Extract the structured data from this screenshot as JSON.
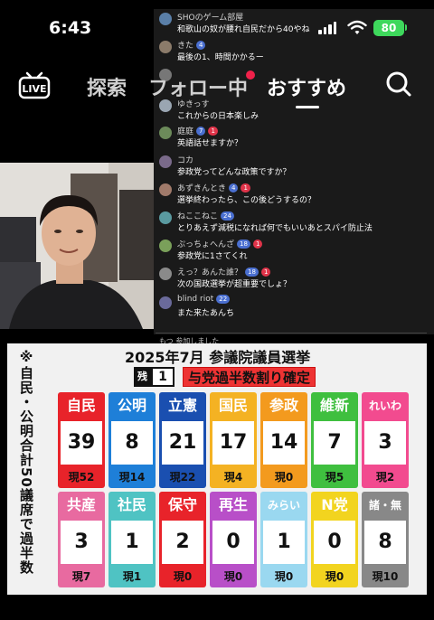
{
  "status_bar": {
    "time": "6:43",
    "battery": "80"
  },
  "nav": {
    "live_label": "LIVE",
    "tabs": [
      "探索",
      "フォロー中",
      "おすすめ"
    ]
  },
  "chat": [
    {
      "name": "SHOのゲーム部屋",
      "badges": [],
      "message": "和歌山の奴が腰れ自民だから40やね",
      "avatar_color": "#5a7fa8"
    },
    {
      "name": "きた",
      "badges": [
        {
          "text": "4",
          "color": "blue"
        }
      ],
      "message": "最後の1、時間かかるー",
      "avatar_color": "#8b7b6a"
    },
    {
      "name": "",
      "badges": [],
      "message": "",
      "avatar_color": "#777777"
    },
    {
      "name": "ゆきっす",
      "badges": [],
      "message": "これからの日本楽しみ",
      "avatar_color": "#9aa6b2"
    },
    {
      "name": "庭庭",
      "badges": [
        {
          "text": "7",
          "color": "blue"
        },
        {
          "text": "1",
          "color": "red"
        }
      ],
      "message": "英語話せますか？",
      "avatar_color": "#6c8a5a"
    },
    {
      "name": "コカ",
      "badges": [],
      "message": "参政党ってどんな政策ですか？",
      "avatar_color": "#7a6a8a"
    },
    {
      "name": "あずきんとき",
      "badges": [
        {
          "text": "4",
          "color": "blue"
        },
        {
          "text": "1",
          "color": "red"
        }
      ],
      "message": "選挙終わったら、この後どうするの？",
      "avatar_color": "#a07a6a"
    },
    {
      "name": "ねここねこ",
      "badges": [
        {
          "text": "24",
          "color": "blue"
        }
      ],
      "message": "とりあえず減税になれば何でもいいあとスパイ防止法",
      "avatar_color": "#5a9aa0"
    },
    {
      "name": "ぷっちょへんざ",
      "badges": [
        {
          "text": "18",
          "color": "blue"
        },
        {
          "text": "1",
          "color": "red"
        }
      ],
      "message": "参政党に1さてくれ",
      "avatar_color": "#7aa05a"
    },
    {
      "name": "えっ？あんた誰？",
      "badges": [
        {
          "text": "18",
          "color": "blue"
        },
        {
          "text": "1",
          "color": "red"
        }
      ],
      "message": "次の国政選挙が超重要でしょ？",
      "avatar_color": "#8a8a8a"
    },
    {
      "name": "blind riot",
      "badges": [
        {
          "text": "22",
          "color": "blue"
        }
      ],
      "message": "また来たあんち",
      "avatar_color": "#6a6a9a"
    }
  ],
  "chat_footer": "もつ 参加しました",
  "board": {
    "side_text": "※自民・公明合計50議席で過半数",
    "title": "2025年7月 参議院議員選挙",
    "remain_label": "残",
    "remain_count": "1",
    "headline": "与党過半数割り確定",
    "parties": [
      {
        "name": "自民",
        "count": "39",
        "current": "現52",
        "color": "#e8232a",
        "current_bg": "#ffffff"
      },
      {
        "name": "公明",
        "count": "8",
        "current": "現14",
        "color": "#1e7fd8",
        "current_bg": "#ffffff"
      },
      {
        "name": "立憲",
        "count": "21",
        "current": "現22",
        "color": "#1a4fb0",
        "current_bg": "#ffffff"
      },
      {
        "name": "国民",
        "count": "17",
        "current": "現4",
        "color": "#f4b223",
        "current_bg": "#ffffff"
      },
      {
        "name": "参政",
        "count": "14",
        "current": "現0",
        "color": "#f39a1e",
        "current_bg": "#ffffff"
      },
      {
        "name": "維新",
        "count": "7",
        "current": "現5",
        "color": "#3fbf3f",
        "current_bg": "#ffffff"
      },
      {
        "name": "れいわ",
        "count": "3",
        "current": "現2",
        "color": "#f24b8f",
        "current_bg": "#ffffff"
      },
      {
        "name": "共産",
        "count": "3",
        "current": "現7",
        "color": "#e86aa0",
        "current_bg": "#ffffff"
      },
      {
        "name": "社民",
        "count": "1",
        "current": "現1",
        "color": "#4fc3c3",
        "current_bg": "#ffffff"
      },
      {
        "name": "保守",
        "count": "2",
        "current": "現0",
        "color": "#e8232a",
        "current_bg": "#ffffff"
      },
      {
        "name": "再生",
        "count": "0",
        "current": "現0",
        "color": "#b84fc8",
        "current_bg": "#ffffff"
      },
      {
        "name": "みらい",
        "count": "1",
        "current": "現0",
        "color": "#9ad8f0",
        "current_bg": "#ffffff"
      },
      {
        "name": "N党",
        "count": "0",
        "current": "現0",
        "color": "#f2d41f",
        "current_bg": "#ffffff"
      },
      {
        "name": "諸・無",
        "count": "8",
        "current": "現10",
        "color": "#888888",
        "current_bg": "#ffffff"
      }
    ]
  }
}
